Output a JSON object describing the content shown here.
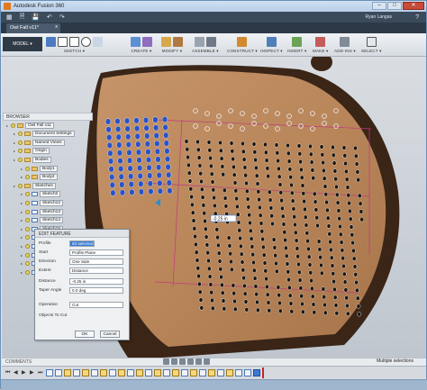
{
  "window": {
    "title": "Autodesk Fusion 360",
    "minimize": "–",
    "maximize": "□",
    "close": "✕"
  },
  "quick_access": {
    "user_name": "Ryan Langas",
    "help": "?"
  },
  "document_tab": {
    "label": "Owl Fall v11*",
    "close": "x"
  },
  "toolbar": {
    "workspace": "MODEL ▾",
    "groups": [
      {
        "label": "SKETCH ▾",
        "icon": "sketch-icon"
      },
      {
        "label": "CREATE ▾",
        "icon": "create-icon"
      },
      {
        "label": "MODIFY ▾",
        "icon": "modify-icon"
      },
      {
        "label": "ASSEMBLE ▾",
        "icon": "assemble-icon"
      },
      {
        "label": "CONSTRUCT ▾",
        "icon": "construct-icon"
      },
      {
        "label": "INSPECT ▾",
        "icon": "inspect-icon"
      },
      {
        "label": "INSERT ▾",
        "icon": "insert-icon"
      },
      {
        "label": "MAKE ▾",
        "icon": "make-icon"
      },
      {
        "label": "ADD-INS ▾",
        "icon": "addins-icon"
      },
      {
        "label": "SELECT ▾",
        "icon": "select-icon"
      }
    ]
  },
  "browser": {
    "header": "BROWSER",
    "items": [
      {
        "label": "Owl Fall v11",
        "type": "root",
        "selected": false
      },
      {
        "label": "Document Settings",
        "type": "folder",
        "selected": false
      },
      {
        "label": "Named Views",
        "type": "folder",
        "selected": false
      },
      {
        "label": "Origin",
        "type": "folder",
        "selected": false
      },
      {
        "label": "Bodies",
        "type": "folder",
        "selected": false
      },
      {
        "label": "Body1",
        "type": "body",
        "selected": false
      },
      {
        "label": "Body2",
        "type": "body",
        "selected": false
      },
      {
        "label": "Sketches",
        "type": "folder",
        "selected": false
      },
      {
        "label": "Sketch2",
        "type": "sketch",
        "selected": false
      },
      {
        "label": "Sketch12",
        "type": "sketch",
        "selected": false
      },
      {
        "label": "Sketch13",
        "type": "sketch",
        "selected": false
      },
      {
        "label": "Sketch14",
        "type": "sketch",
        "selected": false
      },
      {
        "label": "Sketch15",
        "type": "sketch",
        "selected": false
      },
      {
        "label": "Sketch16",
        "type": "sketch",
        "selected": false
      },
      {
        "label": "Sketch17",
        "type": "sketch",
        "selected": false
      },
      {
        "label": "Sketch18",
        "type": "sketch",
        "selected": false
      },
      {
        "label": "Sketch19",
        "type": "sketch",
        "selected": false
      },
      {
        "label": "Sketch24",
        "type": "sketch",
        "selected": true
      }
    ]
  },
  "edit_feature": {
    "title": "EDIT FEATURE",
    "rows": [
      {
        "label": "Profile",
        "value": "63 selected"
      },
      {
        "label": "Start",
        "value": "Profile Plane"
      },
      {
        "label": "Direction",
        "value": "One Side"
      },
      {
        "label": "Extent",
        "value": "Distance"
      },
      {
        "label": "Distance",
        "value": "-0.25 in"
      },
      {
        "label": "Taper Angle",
        "value": "0.0 deg"
      },
      {
        "label": "Operation",
        "value": "Cut"
      },
      {
        "label": "Objects To Cut",
        "value": ""
      }
    ],
    "ok": "OK",
    "cancel": "Cancel"
  },
  "viewport": {
    "dimension_input": "-0.25 in"
  },
  "comments": {
    "label": "COMMENTS"
  },
  "status": {
    "text": "Multiple selections"
  },
  "colors": {
    "wood": "#b9865a",
    "wood_dark": "#3a2517",
    "hole_blue": "#2a52c9",
    "hole_black": "#1d1712",
    "sketch_line": "#c0397f",
    "accent": "#3a7bd5"
  }
}
